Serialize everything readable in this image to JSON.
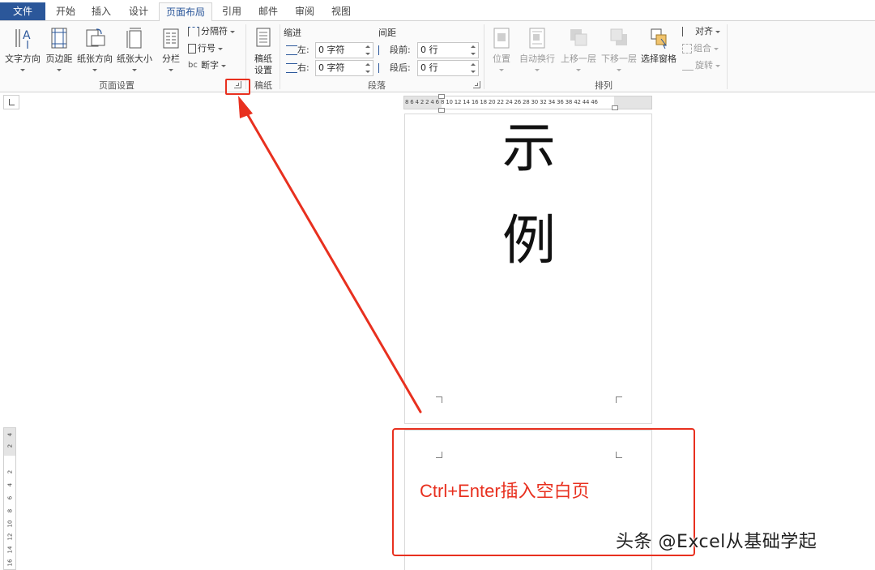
{
  "tabs": [
    {
      "label": "文件"
    },
    {
      "label": "开始"
    },
    {
      "label": "插入"
    },
    {
      "label": "设计"
    },
    {
      "label": "页面布局"
    },
    {
      "label": "引用"
    },
    {
      "label": "邮件"
    },
    {
      "label": "审阅"
    },
    {
      "label": "视图"
    }
  ],
  "active_tab": "页面布局",
  "page_setup": {
    "group_label": "页面设置",
    "text_direction": "文字方向",
    "margins": "页边距",
    "orientation": "纸张方向",
    "size": "纸张大小",
    "columns": "分栏",
    "breaks": "分隔符",
    "line_numbers": "行号",
    "hyphenation": "断字"
  },
  "draft_paper": {
    "group_label": "稿纸",
    "setup_line1": "稿纸",
    "setup_line2": "设置"
  },
  "paragraph": {
    "group_label": "段落",
    "indent_head": "缩进",
    "spacing_head": "间距",
    "left_label": "左:",
    "left_value": "0 字符",
    "right_label": "右:",
    "right_value": "0 字符",
    "before_label": "段前:",
    "before_value": "0 行",
    "after_label": "段后:",
    "after_value": "0 行"
  },
  "arrange": {
    "group_label": "排列",
    "position": "位置",
    "wrap_text": "自动换行",
    "bring_forward": "上移一层",
    "send_backward": "下移一层",
    "selection_pane": "选择窗格",
    "align": "对齐",
    "group": "组合",
    "rotate": "旋转"
  },
  "ruler": {
    "horizontal_numbers": "8 6 4 2     2 4 6 8 10 12 14 16 18 20 22 24 26 28 30 32 34 36 38      42 44 46",
    "vertical_numbers": [
      "4",
      "2",
      "2",
      "4",
      "6",
      "8",
      "10",
      "12",
      "14",
      "16"
    ]
  },
  "document": {
    "char1": "示",
    "char2": "例"
  },
  "annotation": {
    "caption": "Ctrl+Enter插入空白页",
    "color": "#e8301f"
  },
  "watermark": "头条 @Excel从基础学起",
  "colors": {
    "file_tab": "#2b579a",
    "active_tab_text": "#2b579a",
    "annotation": "#e8301f"
  }
}
